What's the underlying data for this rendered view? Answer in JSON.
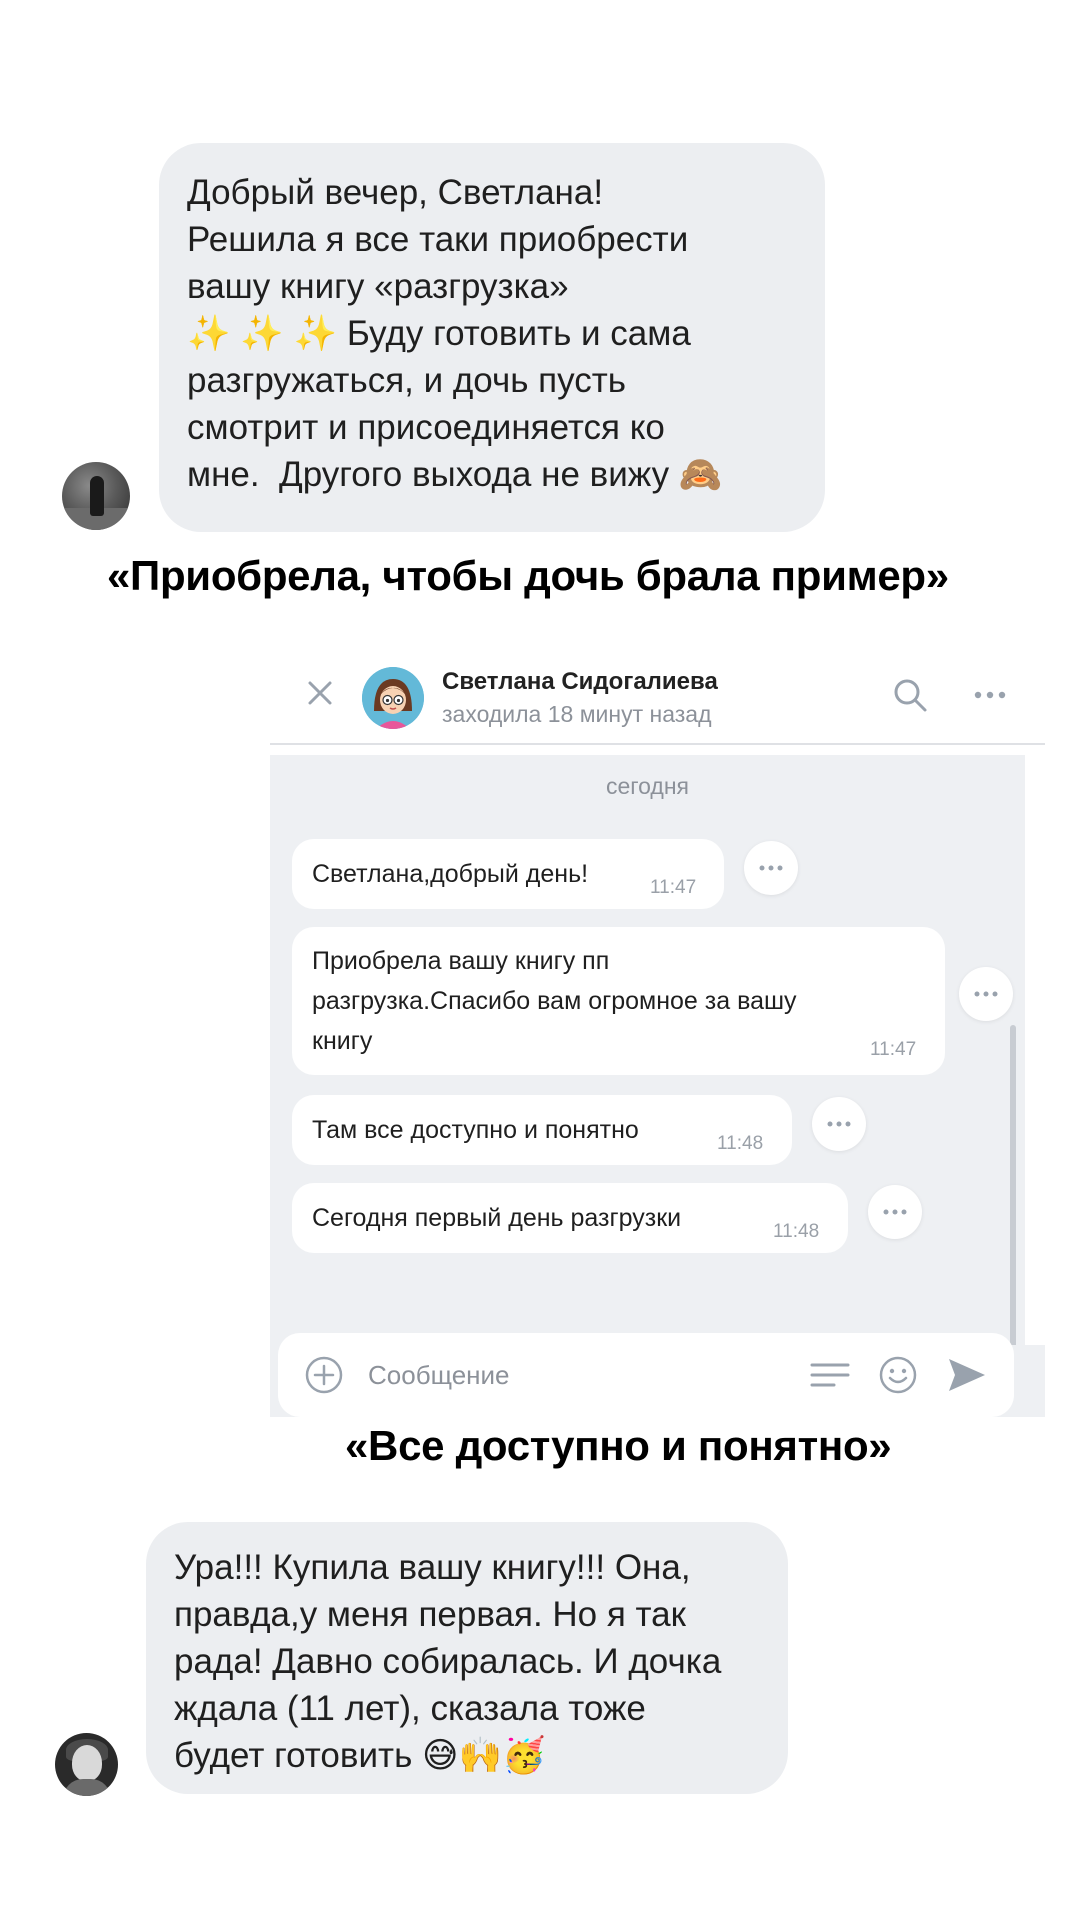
{
  "review_top": {
    "text": "Добрый вечер, Светлана!\nРешила я все таки приобрести\nвашу книгу «разгрузка»\n✨ ✨ ✨ Буду готовить и сама\nразгружаться, и дочь пусть\nсмотрит и присоединяется ко\nмне.  Другого выхода не вижу 🙈"
  },
  "caption_top": "«Приобрела, чтобы дочь брала пример»",
  "chat": {
    "contact_name": "Светлана Сидогалиева",
    "contact_status": "заходила 18 минут назад",
    "date_label": "сегодня",
    "messages": [
      {
        "text": "Светлана,добрый день!",
        "time": "11:47"
      },
      {
        "text": "Приобрела вашу книгу пп\nразгрузка.Спасибо вам огромное за вашу\nкнигу",
        "time": "11:47"
      },
      {
        "text": "Там все доступно и понятно",
        "time": "11:48"
      },
      {
        "text": "Сегодня первый день разгрузки",
        "time": "11:48"
      }
    ],
    "input_placeholder": "Сообщение",
    "icons": [
      "close-icon",
      "search-icon",
      "more-icon",
      "add-icon",
      "templates-icon",
      "emoji-icon",
      "send-icon"
    ],
    "colors": {
      "accent": "#99a2ad",
      "bubble": "#ffffff",
      "background": "#eef0f3"
    }
  },
  "caption_middle": "«Все доступно и понятно»",
  "review_bottom": {
    "text": "Ура!!! Купила вашу книгу!!! Она,\nправда,у меня первая. Но я так\nрада! Давно собиралась. И дочка\nждала (11 лет), сказала тоже\nбудет готовить 😅🙌🥳"
  }
}
